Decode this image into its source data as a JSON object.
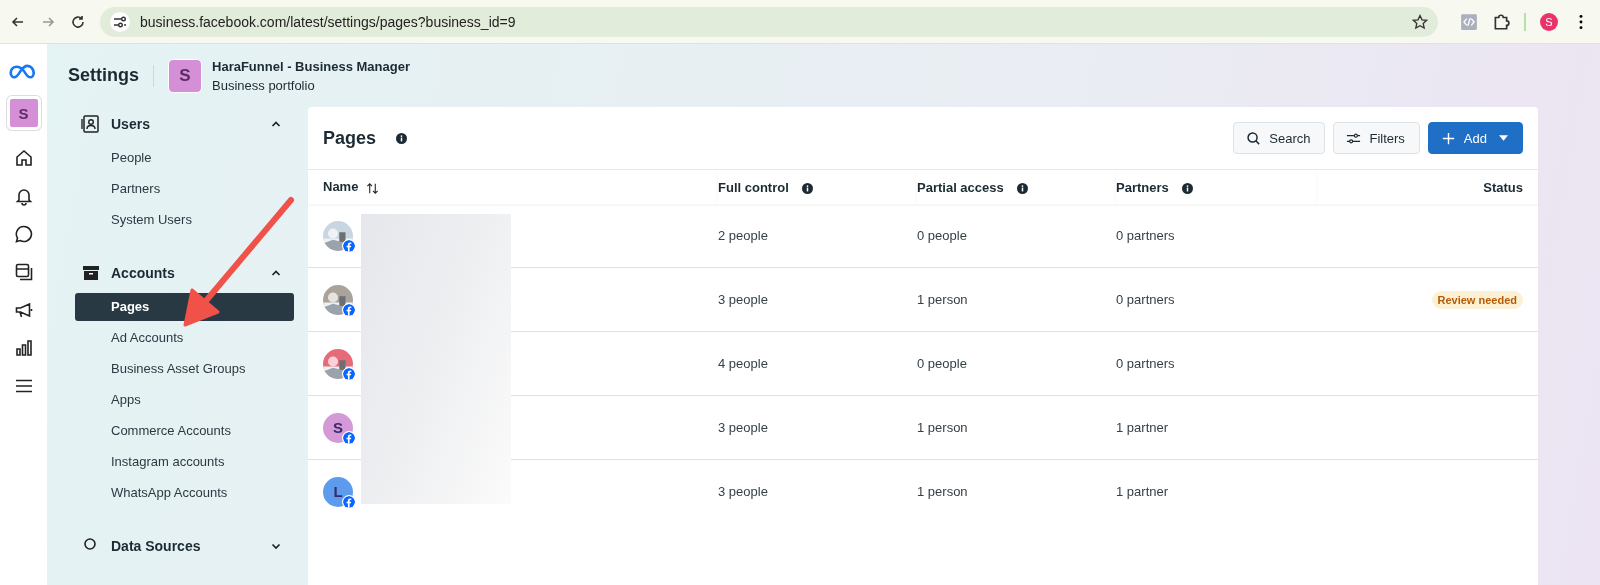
{
  "browser": {
    "url": "business.facebook.com/latest/settings/pages?business_id=9",
    "profile_initial": "S"
  },
  "rail": {
    "avatar_initial": "S"
  },
  "header": {
    "title": "Settings",
    "business": {
      "initial": "S",
      "name": "HaraFunnel - Business Manager",
      "subtitle": "Business portfolio"
    }
  },
  "sidebar": {
    "sections": [
      {
        "label": "Users",
        "kind": "users",
        "expanded": true,
        "items": [
          {
            "label": "People",
            "selected": false
          },
          {
            "label": "Partners",
            "selected": false
          },
          {
            "label": "System Users",
            "selected": false
          }
        ]
      },
      {
        "label": "Accounts",
        "kind": "accounts",
        "expanded": true,
        "items": [
          {
            "label": "Pages",
            "selected": true
          },
          {
            "label": "Ad Accounts",
            "selected": false
          },
          {
            "label": "Business Asset Groups",
            "selected": false
          },
          {
            "label": "Apps",
            "selected": false
          },
          {
            "label": "Commerce Accounts",
            "selected": false
          },
          {
            "label": "Instagram accounts",
            "selected": false
          },
          {
            "label": "WhatsApp Accounts",
            "selected": false
          }
        ]
      },
      {
        "label": "Data Sources",
        "kind": "data",
        "expanded": false
      }
    ]
  },
  "panel": {
    "title": "Pages",
    "search_button": "Search",
    "filters_button": "Filters",
    "add_button": "Add"
  },
  "table": {
    "columns": [
      {
        "label": "Name",
        "kind": "sort"
      },
      {
        "label": "Full control",
        "kind": "info"
      },
      {
        "label": "Partial access",
        "kind": "info"
      },
      {
        "label": "Partners",
        "kind": "info"
      },
      {
        "label": "Status",
        "kind": "plain"
      }
    ],
    "rows": [
      {
        "full_control": "2 people",
        "partial_access": "0 people",
        "partners": "0 partners"
      },
      {
        "full_control": "3 people",
        "partial_access": "1 person",
        "partners": "0 partners",
        "status": "Review needed"
      },
      {
        "full_control": "4 people",
        "partial_access": "0 people",
        "partners": "0 partners"
      },
      {
        "avatar": {
          "kind": "letter",
          "initial": "S",
          "color": "#d49ad8"
        },
        "full_control": "3 people",
        "partial_access": "1 person",
        "partners": "1 partner"
      },
      {
        "avatar": {
          "kind": "letter",
          "initial": "L",
          "color": "#5d9cec"
        },
        "full_control": "3 people",
        "partial_access": "1 person",
        "partners": "1 partner"
      }
    ]
  }
}
